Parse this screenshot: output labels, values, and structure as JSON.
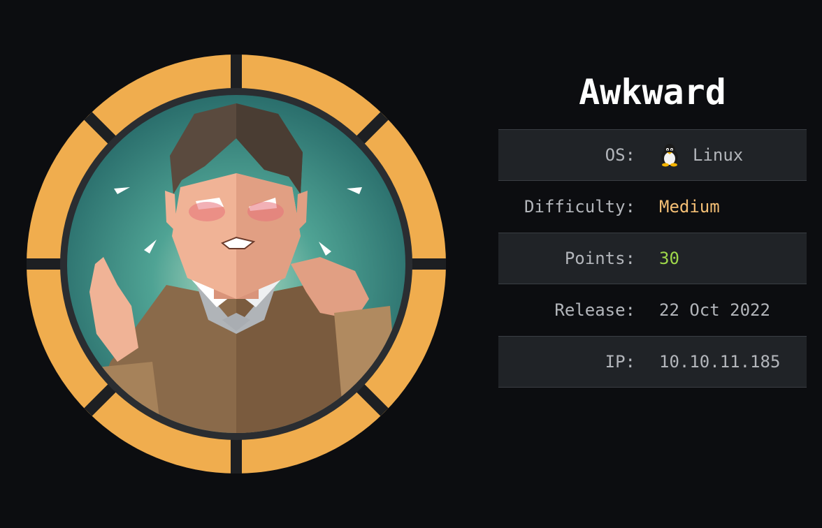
{
  "machine": {
    "name": "Awkward",
    "avatar_icon": "awkward-man-avatar"
  },
  "info": {
    "os": {
      "label": "OS:",
      "value": "Linux",
      "icon": "linux-tux-icon"
    },
    "difficulty": {
      "label": "Difficulty:",
      "value": "Medium",
      "color": "#f4bf75"
    },
    "points": {
      "label": "Points:",
      "value": "30",
      "color": "#9fd84a"
    },
    "release": {
      "label": "Release:",
      "value": "22 Oct 2022"
    },
    "ip": {
      "label": "IP:",
      "value": "10.10.11.185"
    }
  },
  "colors": {
    "background": "#0c0d10",
    "ring": "#f0ad4e",
    "row_shade": "#202327",
    "text": "#b3b6bb"
  }
}
